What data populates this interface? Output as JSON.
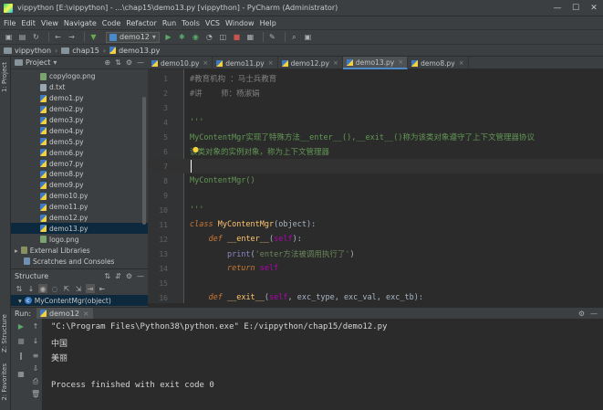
{
  "window": {
    "title": "vippython [E:\\vippython] - ...\\chap15\\demo13.py [vippython] - PyCharm (Administrator)",
    "minimize": "—",
    "maximize": "☐",
    "close": "✕"
  },
  "menu": [
    "File",
    "Edit",
    "View",
    "Navigate",
    "Code",
    "Refactor",
    "Run",
    "Tools",
    "VCS",
    "Window",
    "Help"
  ],
  "toolbar": {
    "run_config": "demo12"
  },
  "breadcrumbs": [
    "vippython",
    "chap15",
    "demo13.py"
  ],
  "left_strip": {
    "project_tab": "1: Project",
    "structure_tab": "Z: Structure",
    "favorites_tab": "2: Favorites"
  },
  "project_panel": {
    "title": "Project",
    "files": [
      {
        "name": "copylogo.png",
        "type": "png"
      },
      {
        "name": "d.txt",
        "type": "txt"
      },
      {
        "name": "demo1.py",
        "type": "py"
      },
      {
        "name": "demo2.py",
        "type": "py"
      },
      {
        "name": "demo3.py",
        "type": "py"
      },
      {
        "name": "demo4.py",
        "type": "py"
      },
      {
        "name": "demo5.py",
        "type": "py"
      },
      {
        "name": "demo6.py",
        "type": "py"
      },
      {
        "name": "demo7.py",
        "type": "py"
      },
      {
        "name": "demo8.py",
        "type": "py"
      },
      {
        "name": "demo9.py",
        "type": "py"
      },
      {
        "name": "demo10.py",
        "type": "py"
      },
      {
        "name": "demo11.py",
        "type": "py"
      },
      {
        "name": "demo12.py",
        "type": "py"
      },
      {
        "name": "demo13.py",
        "type": "py"
      },
      {
        "name": "logo.png",
        "type": "png"
      }
    ],
    "external_libraries": "External Libraries",
    "scratches": "Scratches and Consoles"
  },
  "structure_panel": {
    "title": "Structure",
    "class_item": "MyContentMgr(object)"
  },
  "editor_tabs": [
    "demo10.py",
    "demo11.py",
    "demo12.py",
    "demo13.py",
    "demo8.py"
  ],
  "active_tab": "demo13.py",
  "code_lines": [
    {
      "n": "1",
      "text": "#教育机构 ：马士兵教育"
    },
    {
      "n": "2",
      "text": "#讲    师：杨淑娟"
    },
    {
      "n": "3",
      "text": ""
    },
    {
      "n": "4",
      "text": "'''"
    },
    {
      "n": "5",
      "text": "MyContentMgr实现了特殊方法__enter__(),__exit__()称为该类对象遵守了上下文管理器协议"
    },
    {
      "n": "6",
      "text": "该类对象的实例对象，称为上下文管理器"
    },
    {
      "n": "7",
      "text": ""
    },
    {
      "n": "8",
      "text": "MyContentMgr()"
    },
    {
      "n": "9",
      "text": ""
    },
    {
      "n": "10",
      "text": "'''"
    },
    {
      "n": "11",
      "text": "class MyContentMgr(object):"
    },
    {
      "n": "12",
      "text": "    def __enter__(self):"
    },
    {
      "n": "13",
      "text": "        print('enter方法被调用执行了')"
    },
    {
      "n": "14",
      "text": "        return self"
    },
    {
      "n": "15",
      "text": ""
    },
    {
      "n": "16",
      "text": "    def __exit__(self, exc_type, exc_val, exc_tb):"
    }
  ],
  "run_panel": {
    "label": "Run:",
    "tab": "demo12",
    "output": [
      "\"C:\\Program Files\\Python38\\python.exe\" E:/vippython/chap15/demo12.py",
      "中国",
      "美丽",
      "",
      "Process finished with exit code 0"
    ]
  }
}
